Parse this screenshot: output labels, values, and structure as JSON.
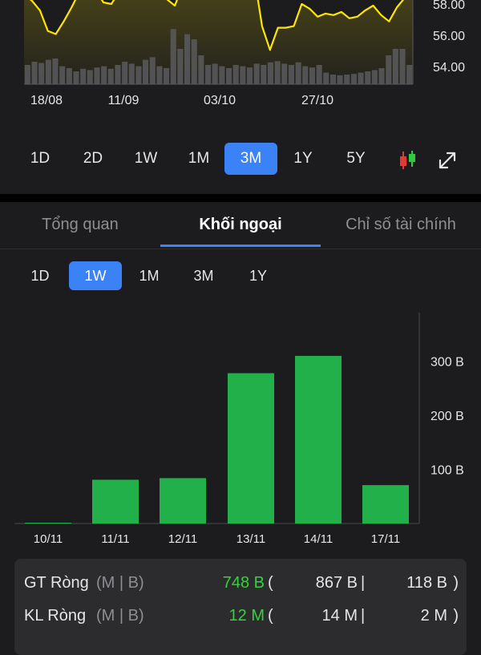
{
  "price_chart": {
    "type": "line",
    "x_ticks": [
      "18/08",
      "11/09",
      "03/10",
      "27/10"
    ],
    "y_ticks": [
      "58.00",
      "56.00",
      "54.00"
    ],
    "line_color": "#ffe600",
    "prices": [
      58.6,
      58.2,
      57.6,
      56.3,
      56.1,
      56.9,
      57.8,
      58.8,
      59.4,
      58.9,
      58.1,
      58.0,
      58.8,
      59.5,
      59.7,
      59.6,
      59.8,
      59.5,
      58.3,
      57.9,
      59.2,
      59.6,
      59.7,
      59.5,
      59.6,
      59.7,
      59.8,
      59.9,
      59.7,
      59.8,
      56.6,
      55.1,
      56.5,
      56.5,
      56.6,
      58.0,
      57.7,
      57.2,
      57.4,
      57.3,
      57.5,
      57.1,
      57.2,
      57.6,
      57.9,
      57.3,
      56.9,
      57.8,
      58.4,
      59.2
    ],
    "volumes": [
      0.3,
      0.35,
      0.33,
      0.38,
      0.4,
      0.28,
      0.25,
      0.2,
      0.24,
      0.22,
      0.26,
      0.28,
      0.24,
      0.3,
      0.35,
      0.32,
      0.28,
      0.38,
      0.42,
      0.28,
      0.25,
      0.86,
      0.55,
      0.78,
      0.7,
      0.45,
      0.3,
      0.32,
      0.28,
      0.25,
      0.3,
      0.28,
      0.26,
      0.32,
      0.3,
      0.34,
      0.36,
      0.32,
      0.3,
      0.34,
      0.28,
      0.26,
      0.3,
      0.18,
      0.15,
      0.14,
      0.15,
      0.16,
      0.18,
      0.2,
      0.22,
      0.25,
      0.45,
      0.55,
      0.55,
      0.3
    ]
  },
  "range_tabs": [
    {
      "label": "1D",
      "active": false
    },
    {
      "label": "2D",
      "active": false
    },
    {
      "label": "1W",
      "active": false
    },
    {
      "label": "1M",
      "active": false
    },
    {
      "label": "3M",
      "active": true
    },
    {
      "label": "1Y",
      "active": false
    },
    {
      "label": "5Y",
      "active": false
    }
  ],
  "tabs": [
    {
      "label": "Tổng quan",
      "active": false
    },
    {
      "label": "Khối ngoại",
      "active": true
    },
    {
      "label": "Chỉ số tài chính",
      "active": false
    }
  ],
  "period_tabs": [
    {
      "label": "1D",
      "active": false
    },
    {
      "label": "1W",
      "active": true
    },
    {
      "label": "1M",
      "active": false
    },
    {
      "label": "3M",
      "active": false
    },
    {
      "label": "1Y",
      "active": false
    }
  ],
  "chart_data": {
    "type": "bar",
    "categories": [
      "10/11",
      "11/11",
      "12/11",
      "13/11",
      "14/11",
      "17/11"
    ],
    "values": [
      1,
      81,
      84,
      278,
      310,
      71
    ],
    "y_ticks": [
      "100 B",
      "200 B",
      "300 B"
    ],
    "ylim": [
      0,
      390
    ],
    "bar_color": "#22b04a"
  },
  "stats": {
    "gt": {
      "label": "GT Ròng",
      "unit": "(M | B)",
      "net": "748 B",
      "open": "(",
      "buy": "867 B",
      "sep": "|",
      "sell": "118 B",
      "close": ")"
    },
    "kl": {
      "label": "KL Ròng",
      "unit": "(M | B)",
      "net": "12 M",
      "open": "(",
      "buy": "14 M",
      "sep": "|",
      "sell": "2 M",
      "close": ")"
    }
  }
}
